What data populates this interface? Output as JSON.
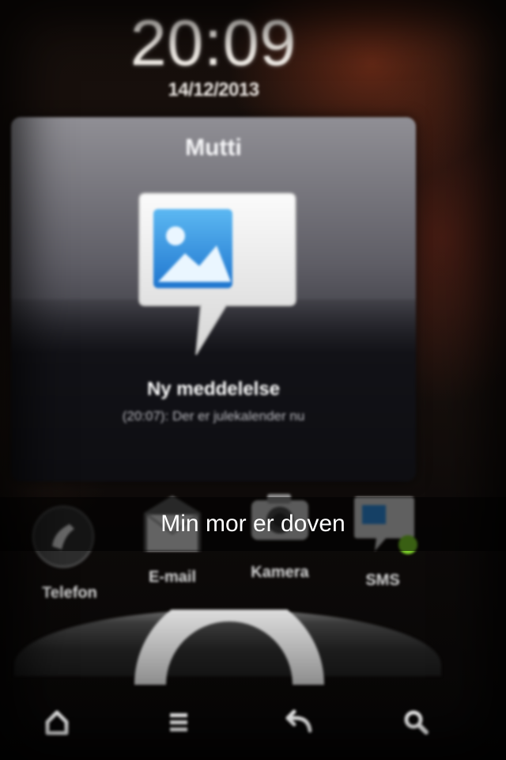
{
  "lockscreen": {
    "time": "20:09",
    "date": "14/12/2013"
  },
  "notification": {
    "contact": "Mutti",
    "icon": "message-bubble-image-icon",
    "title": "Ny meddelelse",
    "preview": "(20:07): Der er julekalender nu"
  },
  "dock": {
    "items": [
      {
        "label": "Telefon",
        "icon": "phone-icon"
      },
      {
        "label": "E-mail",
        "icon": "email-icon"
      },
      {
        "label": "Kamera",
        "icon": "camera-icon"
      },
      {
        "label": "SMS",
        "icon": "sms-icon"
      }
    ]
  },
  "caption": {
    "text": "Min mor er doven"
  },
  "navbar": {
    "items": [
      {
        "icon": "home-icon"
      },
      {
        "icon": "menu-icon"
      },
      {
        "icon": "back-icon"
      },
      {
        "icon": "search-icon"
      }
    ]
  },
  "colors": {
    "caption_bg": "#000000",
    "sms_badge": "#7fd32a",
    "gallery_blue": "#2f8fe0"
  }
}
